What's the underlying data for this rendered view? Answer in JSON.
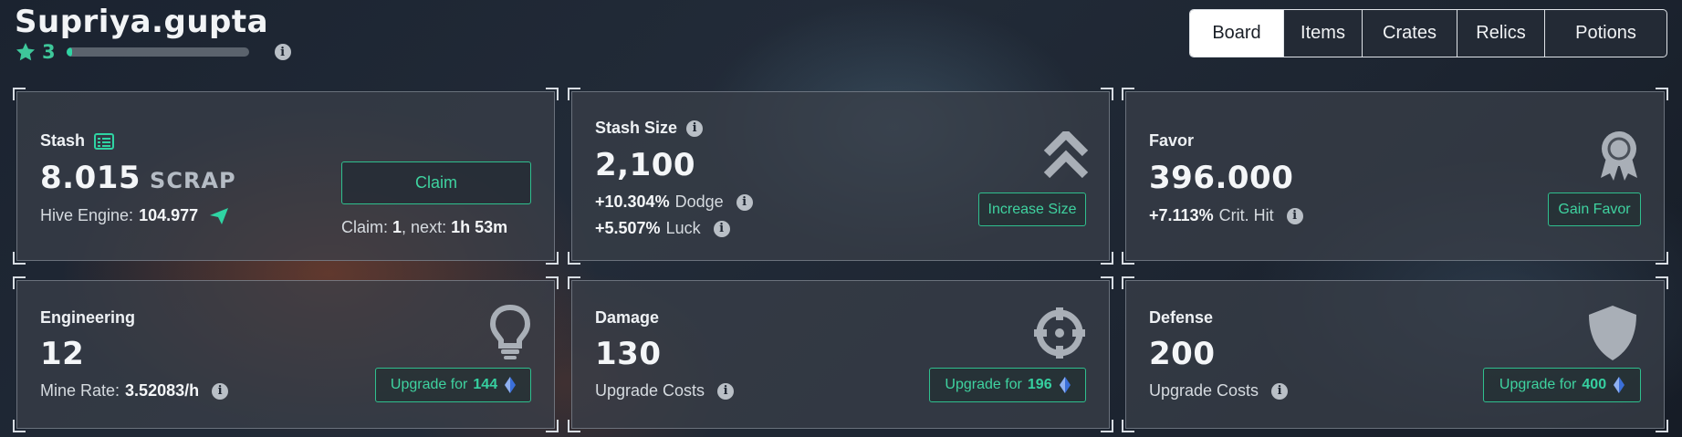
{
  "header": {
    "username": "Supriya.gupta",
    "level": "3",
    "xp_fraction": 0.03,
    "icons": {
      "level": "star-icon",
      "xp_info": "info-icon"
    }
  },
  "tabs": [
    {
      "label": "Board",
      "active": true
    },
    {
      "label": "Items",
      "active": false
    },
    {
      "label": "Crates",
      "active": false
    },
    {
      "label": "Relics",
      "active": false
    },
    {
      "label": "Potions",
      "active": false
    }
  ],
  "colors": {
    "accent": "#2fd4a3",
    "card_bg": "#3a404a",
    "text": "#e9edf1",
    "gem": "#3b6fd8"
  },
  "stash": {
    "title": "Stash",
    "title_icon": "list-icon",
    "value": "8.015",
    "unit": "SCRAP",
    "hive_label": "Hive Engine:",
    "hive_value": "104.977",
    "hive_icon": "send-icon",
    "claim_button": "Claim",
    "claim_label": "Claim:",
    "claim_count": "1",
    "next_label": ", next:",
    "next_time": "1h 53m"
  },
  "stash_size": {
    "title": "Stash Size",
    "value": "2,100",
    "dodge_value": "+10.304%",
    "dodge_label": "Dodge",
    "luck_value": "+5.507%",
    "luck_label": "Luck",
    "button": "Increase Size",
    "icon": "double-chevron-up-icon"
  },
  "favor": {
    "title": "Favor",
    "value": "396.000",
    "crit_value": "+7.113%",
    "crit_label": "Crit. Hit",
    "button": "Gain Favor",
    "icon": "award-icon"
  },
  "engineering": {
    "title": "Engineering",
    "value": "12",
    "rate_label": "Mine Rate:",
    "rate_value": "3.52083/h",
    "button_label": "Upgrade for",
    "button_cost": "144",
    "icon": "lightbulb-icon"
  },
  "damage": {
    "title": "Damage",
    "value": "130",
    "costs_label": "Upgrade Costs",
    "button_label": "Upgrade for",
    "button_cost": "196",
    "icon": "crosshair-icon"
  },
  "defense": {
    "title": "Defense",
    "value": "200",
    "costs_label": "Upgrade Costs",
    "button_label": "Upgrade for",
    "button_cost": "400",
    "icon": "shield-icon"
  }
}
